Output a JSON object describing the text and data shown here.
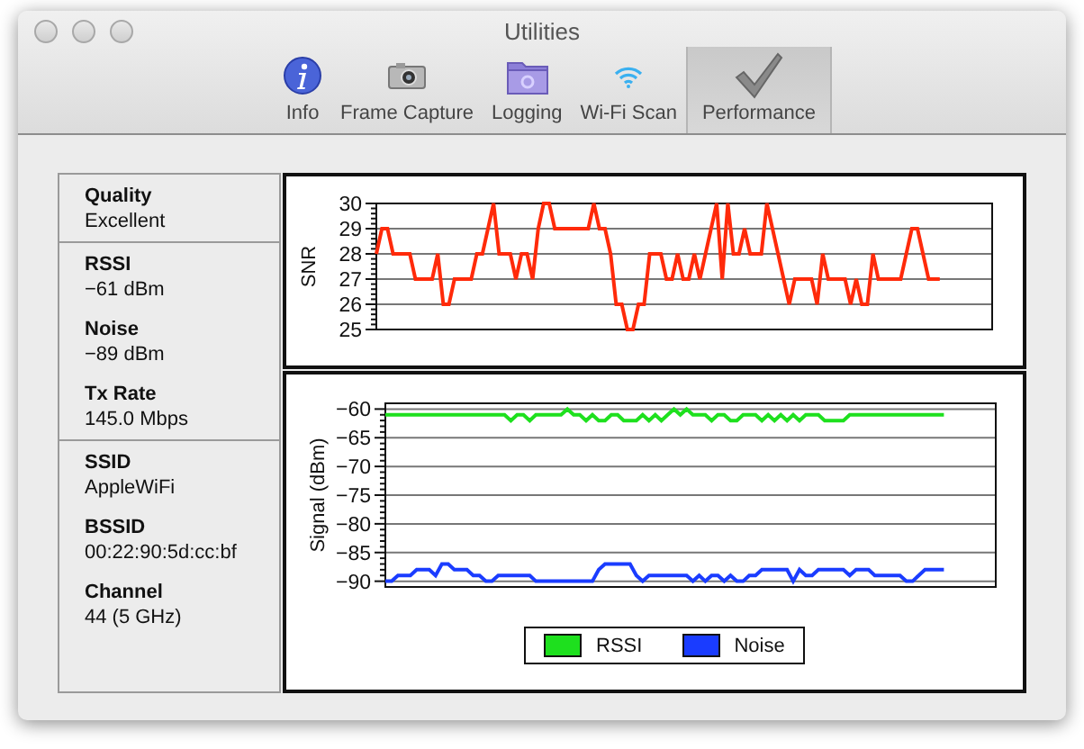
{
  "window": {
    "title": "Utilities"
  },
  "toolbar": [
    {
      "label": "Info",
      "selected": false
    },
    {
      "label": "Frame Capture",
      "selected": false
    },
    {
      "label": "Logging",
      "selected": false
    },
    {
      "label": "Wi-Fi Scan",
      "selected": false
    },
    {
      "label": "Performance",
      "selected": true
    }
  ],
  "info_groups": [
    [
      {
        "label": "Quality",
        "value": "Excellent"
      }
    ],
    [
      {
        "label": "RSSI",
        "value": "−61 dBm"
      },
      {
        "label": "Noise",
        "value": "−89 dBm"
      },
      {
        "label": "Tx Rate",
        "value": "145.0 Mbps"
      }
    ],
    [
      {
        "label": "SSID",
        "value": "AppleWiFi"
      },
      {
        "label": "BSSID",
        "value": "00:22:90:5d:cc:bf"
      },
      {
        "label": "Channel",
        "value": "44 (5 GHz)"
      }
    ]
  ],
  "snr_chart": {
    "chart_data": {
      "type": "line",
      "ylabel": "SNR",
      "grid": true,
      "ylim": [
        25,
        30
      ],
      "yticks": [
        25,
        26,
        27,
        28,
        29,
        30
      ],
      "series": [
        {
          "color": "#ff2a0a",
          "values": [
            28,
            29,
            29,
            28,
            28,
            28,
            28,
            27,
            27,
            27,
            27,
            28,
            26,
            26,
            27,
            27,
            27,
            27,
            28,
            28,
            29,
            30,
            28,
            28,
            28,
            27,
            28,
            28,
            27,
            29,
            30,
            30,
            29,
            29,
            29,
            29,
            29,
            29,
            29,
            30,
            29,
            29,
            28,
            26,
            26,
            25,
            25,
            26,
            26,
            28,
            28,
            28,
            27,
            27,
            28,
            27,
            27,
            28,
            27,
            28,
            29,
            30,
            27,
            30,
            28,
            28,
            29,
            28,
            28,
            28,
            30,
            29,
            28,
            27,
            26,
            27,
            27,
            27,
            27,
            26,
            28,
            27,
            27,
            27,
            27,
            26,
            27,
            26,
            26,
            28,
            27,
            27,
            27,
            27,
            27,
            28,
            29,
            29,
            28,
            27,
            27,
            27
          ]
        }
      ]
    }
  },
  "signal_chart": {
    "chart_data": {
      "type": "line",
      "ylabel": "Signal (dBm)",
      "grid": true,
      "ylim": [
        -91,
        -59
      ],
      "yticks": [
        {
          "value": -90,
          "label": "−90"
        },
        {
          "value": -85,
          "label": "−85"
        },
        {
          "value": -80,
          "label": "−80"
        },
        {
          "value": -75,
          "label": "−75"
        },
        {
          "value": -70,
          "label": "−70"
        },
        {
          "value": -65,
          "label": "−65"
        },
        {
          "value": -60,
          "label": "−60"
        }
      ],
      "series": [
        {
          "name": "RSSI",
          "color": "#1ee01e",
          "values": [
            -61,
            -61,
            -61,
            -61,
            -61,
            -61,
            -61,
            -61,
            -61,
            -61,
            -61,
            -61,
            -61,
            -61,
            -61,
            -61,
            -61,
            -61,
            -61,
            -61,
            -62,
            -61,
            -61,
            -62,
            -61,
            -61,
            -61,
            -61,
            -61,
            -60,
            -61,
            -61,
            -62,
            -61,
            -62,
            -62,
            -61,
            -61,
            -62,
            -62,
            -62,
            -61,
            -62,
            -61,
            -62,
            -61,
            -60,
            -61,
            -60,
            -61,
            -61,
            -61,
            -62,
            -61,
            -61,
            -62,
            -62,
            -61,
            -61,
            -61,
            -62,
            -61,
            -62,
            -61,
            -62,
            -61,
            -62,
            -61,
            -61,
            -61,
            -62,
            -62,
            -62,
            -62,
            -61,
            -61,
            -61,
            -61,
            -61,
            -61,
            -61,
            -61,
            -61,
            -61,
            -61,
            -61,
            -61,
            -61,
            -61,
            -61
          ]
        },
        {
          "name": "Noise",
          "color": "#1a3cff",
          "values": [
            -90,
            -90,
            -89,
            -89,
            -89,
            -88,
            -88,
            -88,
            -89,
            -87,
            -87,
            -88,
            -88,
            -88,
            -89,
            -89,
            -90,
            -90,
            -89,
            -89,
            -89,
            -89,
            -89,
            -89,
            -90,
            -90,
            -90,
            -90,
            -90,
            -90,
            -90,
            -90,
            -90,
            -90,
            -88,
            -87,
            -87,
            -87,
            -87,
            -87,
            -89,
            -90,
            -89,
            -89,
            -89,
            -89,
            -89,
            -89,
            -89,
            -90,
            -89,
            -90,
            -89,
            -89,
            -90,
            -89,
            -90,
            -90,
            -89,
            -89,
            -88,
            -88,
            -88,
            -88,
            -88,
            -90,
            -88,
            -89,
            -89,
            -88,
            -88,
            -88,
            -88,
            -88,
            -89,
            -88,
            -88,
            -88,
            -89,
            -89,
            -89,
            -89,
            -89,
            -90,
            -90,
            -89,
            -88,
            -88,
            -88,
            -88
          ]
        }
      ]
    }
  }
}
